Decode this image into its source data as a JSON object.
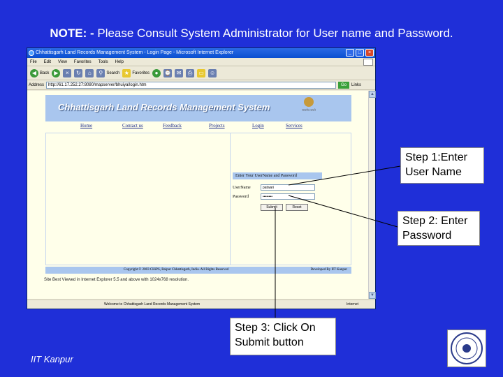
{
  "slide": {
    "note_prefix": "NOTE: - ",
    "note_text": "Please Consult System Administrator for User name and Password.",
    "credit": "IIT Kanpur"
  },
  "window": {
    "title": "Chhattisgarh Land Records Management System - Login Page - Microsoft Internet Explorer",
    "menu": [
      "File",
      "Edit",
      "View",
      "Favorites",
      "Tools",
      "Help"
    ],
    "toolbar": {
      "back": "Back",
      "search": "Search",
      "favorites": "Favorites"
    },
    "address_label": "Address",
    "address_value": "http://61.17.252.27:8080/mapserver/bhuiya/login.htm",
    "go_label": "Go",
    "links_label": "Links"
  },
  "site": {
    "banner_title": "Chhattisgarh Land Records Management System",
    "emblem_text": "सत्यमेव जयते",
    "nav": [
      "Home",
      "Contact us",
      "Feedback",
      "Projects",
      "Login",
      "Services"
    ],
    "login_heading": "Enter Your UserName and Password",
    "username_label": "UserName",
    "username_value": "patwari",
    "password_label": "Password",
    "password_value": "••••••••",
    "submit_label": "Submit",
    "reset_label": "Reset",
    "copyright": "Copyright © 2003 CHiPS, Raipur Chhattisgarh, India. All Rights Reserved",
    "developer": "Developed By IIT Kanpur",
    "best_viewed": "Site Best Viewed in Internet Explorer 5.5 and above with 1024x768 resolution."
  },
  "status": {
    "message": "Welcome to Chhattisgarh Land Records Management System",
    "zone": "Internet"
  },
  "callouts": {
    "step1": "Step 1:Enter User Name",
    "step2": "Step 2: Enter Password",
    "step3": "Step 3: Click On Submit button"
  }
}
